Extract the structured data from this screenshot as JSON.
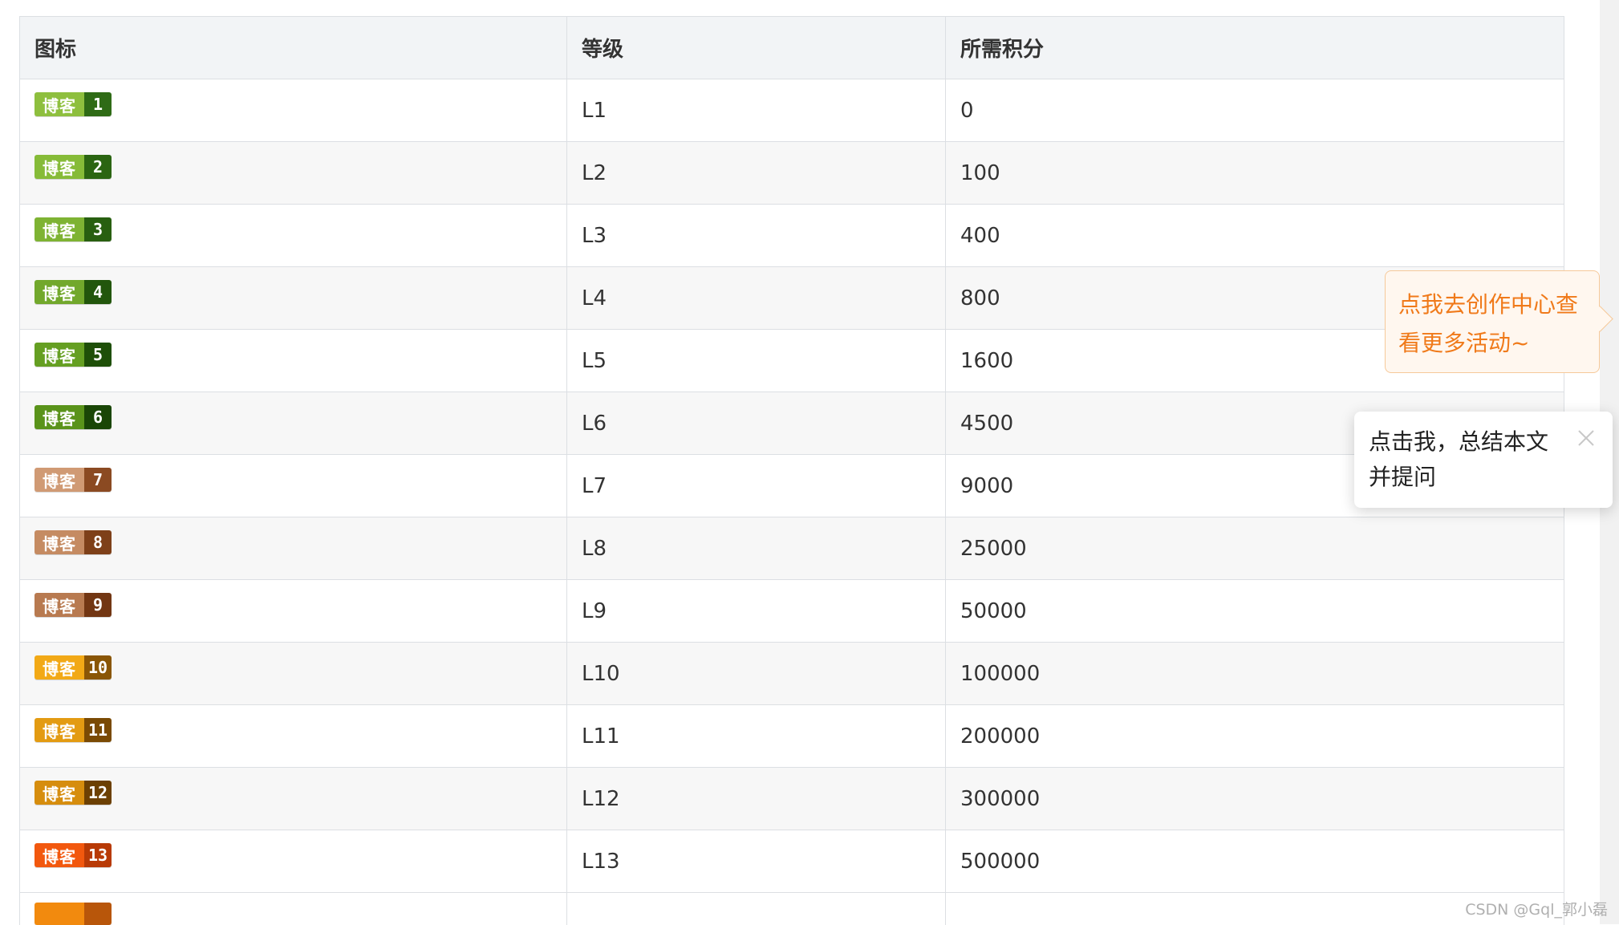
{
  "table": {
    "headers": [
      "图标",
      "等级",
      "所需积分"
    ],
    "rows": [
      {
        "badge_text": "博客",
        "badge_level": "1",
        "level": "L1",
        "points": "0",
        "left": "#8ebf3e",
        "right": "#2f6b16"
      },
      {
        "badge_text": "博客",
        "badge_level": "2",
        "level": "L2",
        "points": "100",
        "left": "#86bb38",
        "right": "#2b6512"
      },
      {
        "badge_text": "博客",
        "badge_level": "3",
        "level": "L3",
        "points": "400",
        "left": "#7eb333",
        "right": "#285f10"
      },
      {
        "badge_text": "博客",
        "badge_level": "4",
        "level": "L4",
        "points": "800",
        "left": "#72a82c",
        "right": "#22560c"
      },
      {
        "badge_text": "博客",
        "badge_level": "5",
        "level": "L5",
        "points": "1600",
        "left": "#659f22",
        "right": "#1e4f08"
      },
      {
        "badge_text": "博客",
        "badge_level": "6",
        "level": "L6",
        "points": "4500",
        "left": "#5a931a",
        "right": "#1a4606"
      },
      {
        "badge_text": "博客",
        "badge_level": "7",
        "level": "L7",
        "points": "9000",
        "left": "#d09a74",
        "right": "#8b4a22"
      },
      {
        "badge_text": "博客",
        "badge_level": "8",
        "level": "L8",
        "points": "25000",
        "left": "#c58b62",
        "right": "#7e4019"
      },
      {
        "badge_text": "博客",
        "badge_level": "9",
        "level": "L9",
        "points": "50000",
        "left": "#b87a50",
        "right": "#723613"
      },
      {
        "badge_text": "博客",
        "badge_level": "10",
        "level": "L10",
        "points": "100000",
        "left": "#f2a916",
        "right": "#8a5606"
      },
      {
        "badge_text": "博客",
        "badge_level": "11",
        "level": "L11",
        "points": "200000",
        "left": "#e39b12",
        "right": "#7a4a04"
      },
      {
        "badge_text": "博客",
        "badge_level": "12",
        "level": "L12",
        "points": "300000",
        "left": "#d68d0e",
        "right": "#6c4003"
      },
      {
        "badge_text": "博客",
        "badge_level": "13",
        "level": "L13",
        "points": "500000",
        "left": "#f2580e",
        "right": "#b83a06"
      }
    ]
  },
  "tooltip_orange": {
    "text": "点我去创作中心查看更多活动~"
  },
  "tooltip_white": {
    "text": "点击我，总结本文并提问"
  },
  "watermark": "CSDN @Gql_郭小磊"
}
